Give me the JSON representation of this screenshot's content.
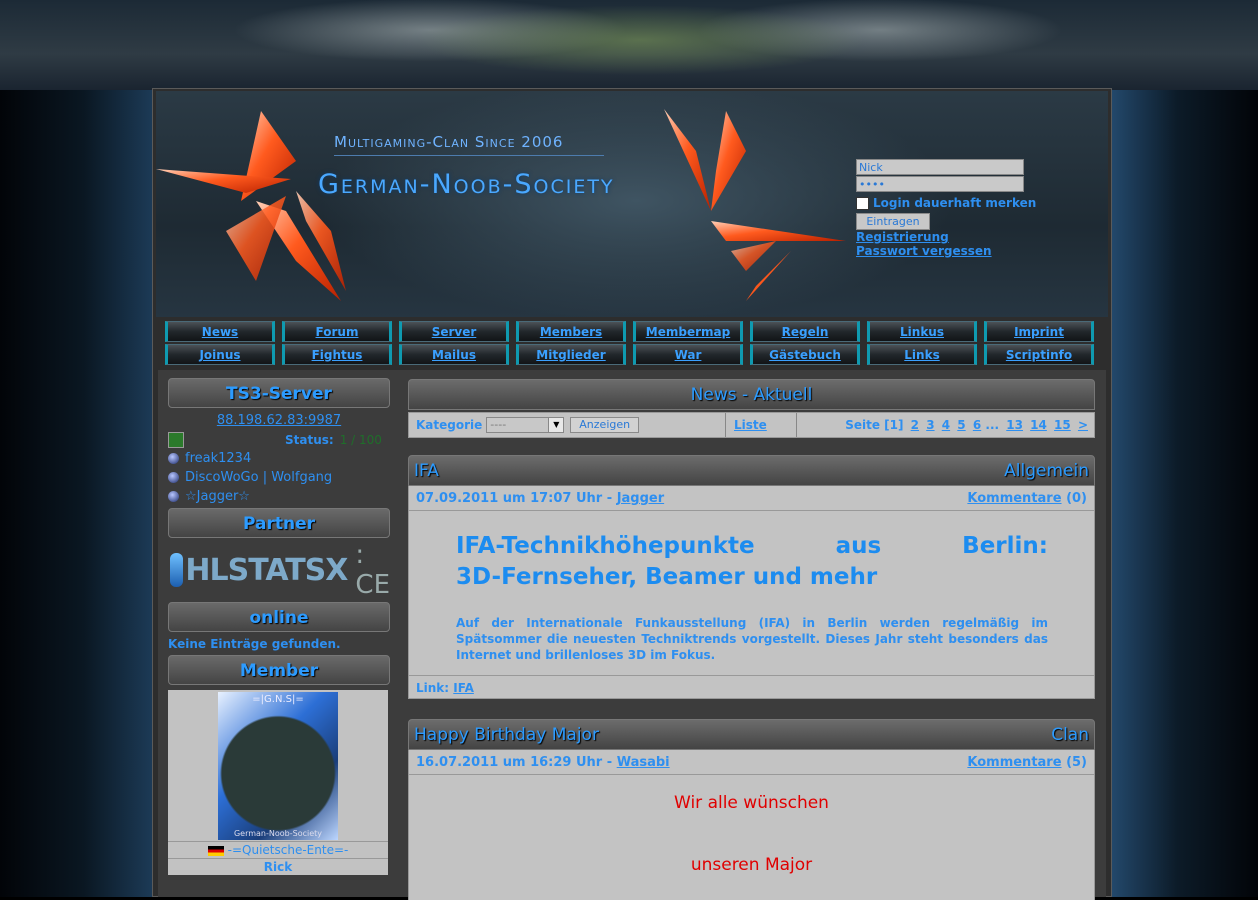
{
  "header": {
    "tagline": "Multigaming-Clan Since 2006",
    "site_name": "German-Noob-Society"
  },
  "login": {
    "nick_value": "Nick",
    "password_value": "••••",
    "remember_label": "Login dauerhaft merken",
    "submit_label": "Eintragen",
    "register_link": "Registrierung",
    "forgot_link": "Passwort vergessen"
  },
  "nav": {
    "row1": [
      "News",
      "Forum",
      "Server",
      "Members",
      "Membermap",
      "Regeln",
      "Linkus",
      "Imprint"
    ],
    "row2": [
      "Joinus",
      "Fightus",
      "Mailus",
      "Mitglieder",
      "War",
      "Gästebuch",
      "Links",
      "Scriptinfo"
    ]
  },
  "sidebar": {
    "ts3_title": "TS3-Server",
    "ts3_ip": "88.198.62.83:9987",
    "status_label": "Status:",
    "status_value": "1 / 100",
    "users": [
      "freak1234",
      "DiscoWoGo | Wolfgang",
      "☆Jagger☆"
    ],
    "partner_title": "Partner",
    "partner_logo_text": "HLSTATSX",
    "partner_logo_suffix": ": CE",
    "online_title": "online",
    "online_empty": "Keine Einträge gefunden.",
    "member_title": "Member",
    "member_img_tag": "=|G.N.S|=",
    "member_img_footer": "German-Noob-Society",
    "member_name": "-=Quietsche-Ente=-",
    "member_next": "Rick"
  },
  "main": {
    "title": "News - Aktuell",
    "filter": {
      "category_label": "Kategorie",
      "category_value": "----",
      "show_button": "Anzeigen",
      "list_link": "Liste",
      "page_label": "Seite [1]",
      "pages": [
        "2",
        "3",
        "4",
        "5",
        "6",
        "...",
        "13",
        "14",
        "15",
        ">"
      ]
    },
    "news": [
      {
        "title": "IFA",
        "category": "Allgemein",
        "date": "07.09.2011 um 17:07 Uhr -",
        "author": "Jagger",
        "comments_label": "Kommentare",
        "comments_count": "(0)",
        "headline_line1": "IFA-Technikhöhepunkte aus Berlin:",
        "headline_line2": "3D-Fernseher, Beamer und mehr",
        "body": "Auf der Internationale Funkausstellung (IFA) in Berlin werden regelmäßig im Spätsommer die neuesten Techniktrends vorgestellt. Dieses Jahr steht besonders das Internet und brillenloses 3D im Fokus.",
        "link_label": "Link:",
        "link_text": "IFA"
      },
      {
        "title": "Happy Birthday Major",
        "category": "Clan",
        "date": "16.07.2011 um 16:29 Uhr -",
        "author": "Wasabi",
        "comments_label": "Kommentare",
        "comments_count": "(5)",
        "body_line1": "Wir alle wünschen",
        "body_line2": "unseren Major"
      }
    ]
  }
}
